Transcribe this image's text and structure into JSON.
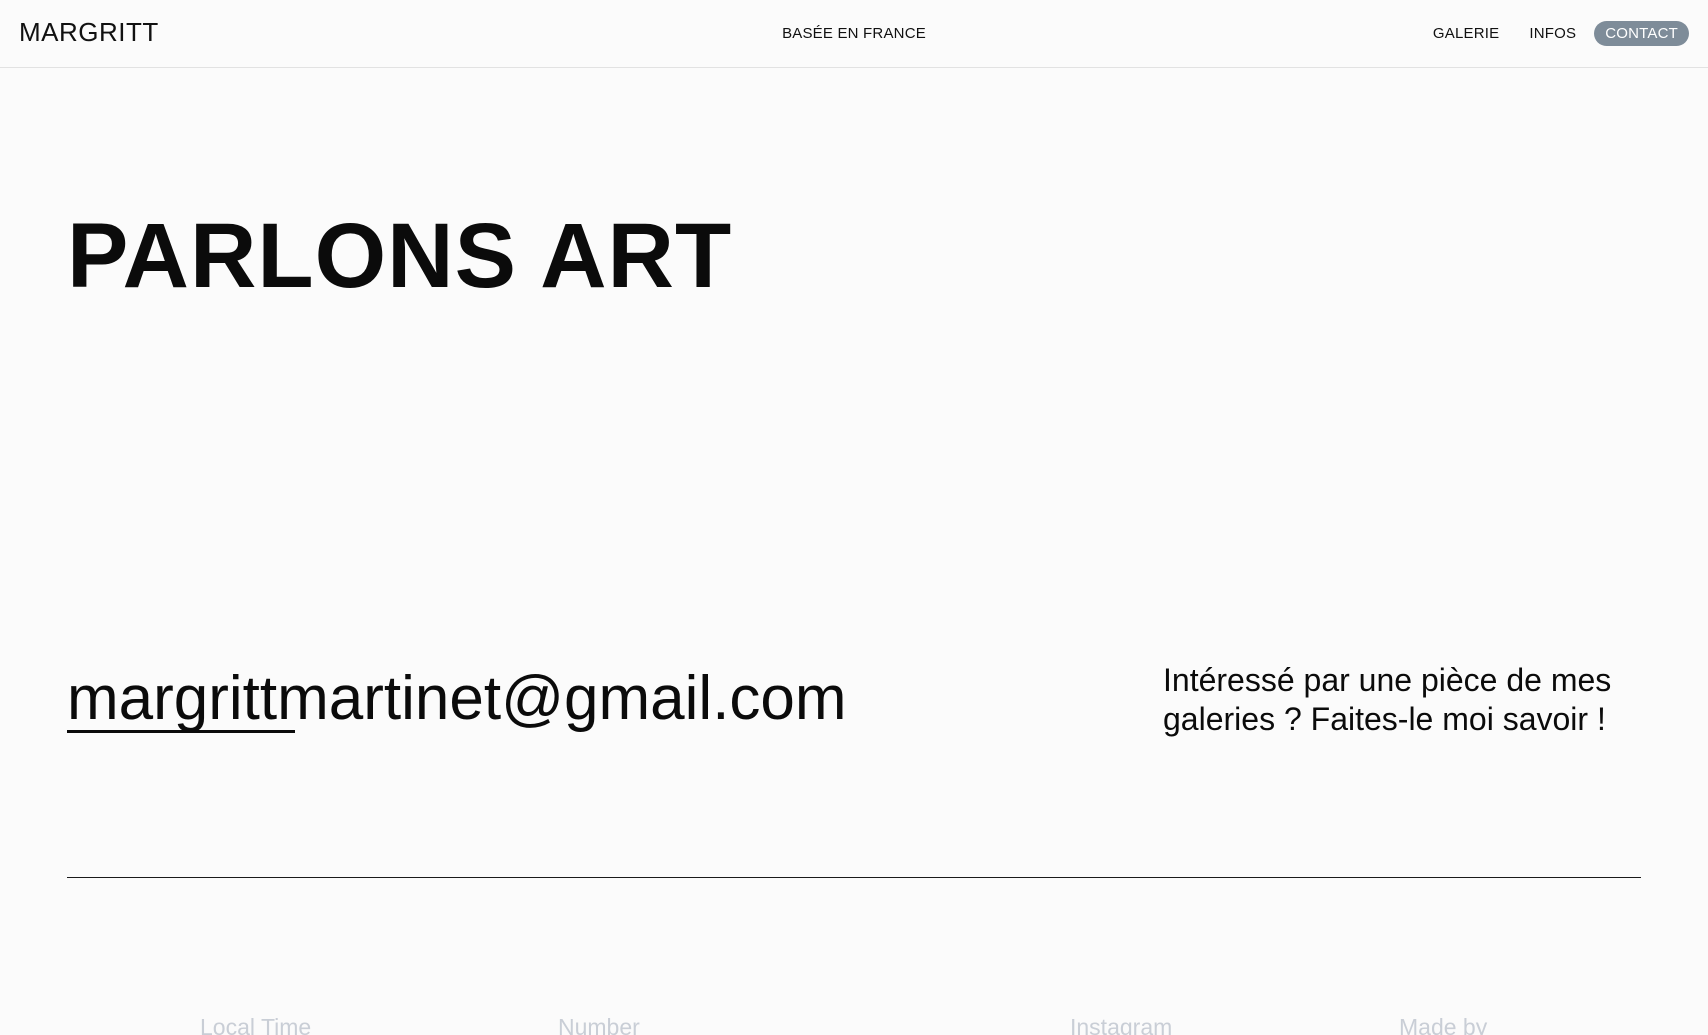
{
  "header": {
    "logo": "MARGRITT",
    "tagline": "BASÉE EN FRANCE",
    "nav": [
      {
        "label": "GALERIE",
        "active": false
      },
      {
        "label": "INFOS",
        "active": false
      },
      {
        "label": "CONTACT",
        "active": true
      }
    ]
  },
  "hero": {
    "title": "PARLONS ART"
  },
  "contact": {
    "email": "margrittmartinet@gmail.com",
    "blurb_line1": "Intéressé par une pièce de mes",
    "blurb_line2": "galeries ? Faites-le moi savoir !"
  },
  "footer": {
    "labels": [
      "Local Time",
      "Number",
      "Instagram",
      "Made by"
    ]
  },
  "colors": {
    "background": "#fbfbfb",
    "text": "#0b0b0b",
    "active_nav_bg": "#7e8c99",
    "footer_label": "#c9ced6"
  }
}
